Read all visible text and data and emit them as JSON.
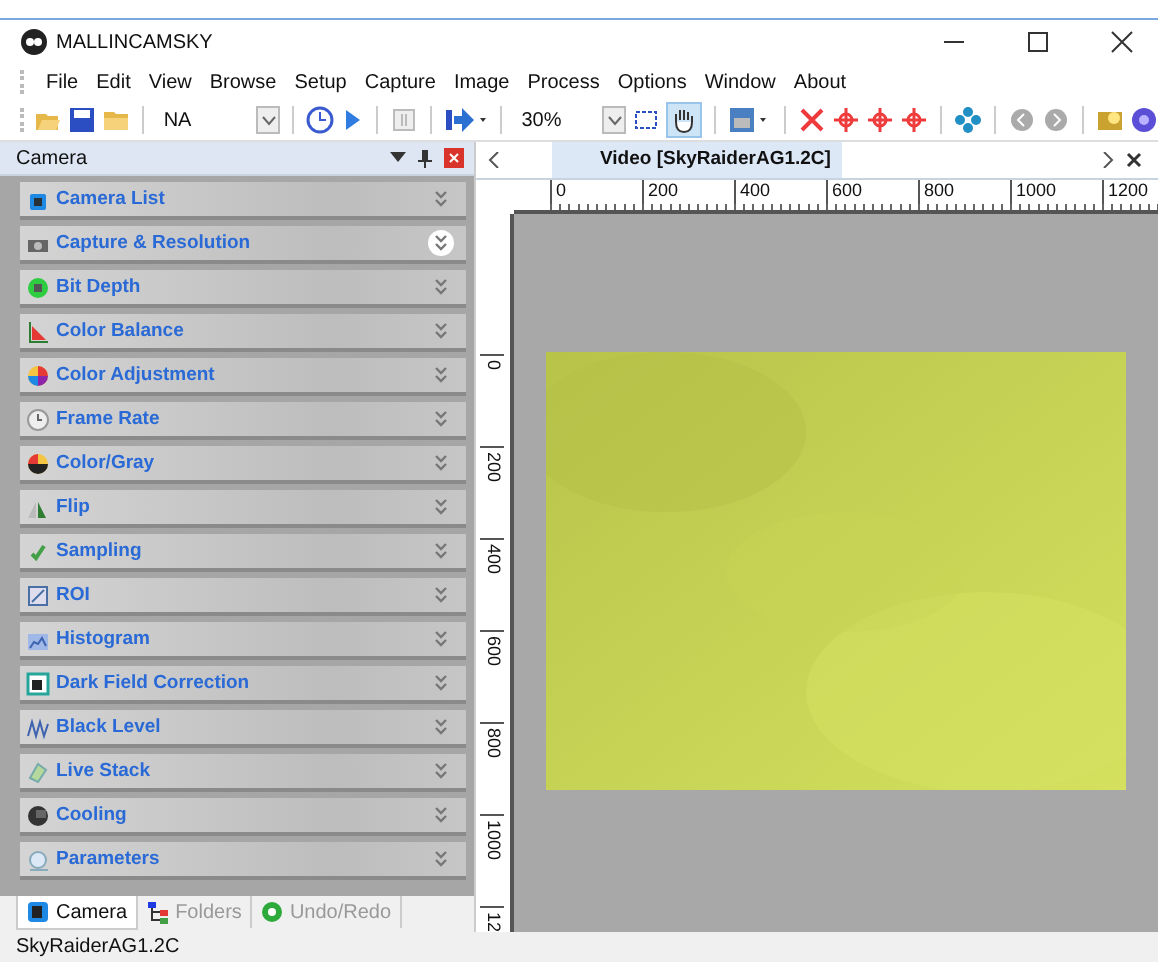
{
  "window": {
    "title": "MALLINCAMSKY"
  },
  "menu": [
    "File",
    "Edit",
    "View",
    "Browse",
    "Setup",
    "Capture",
    "Image",
    "Process",
    "Options",
    "Window",
    "About"
  ],
  "toolbar": {
    "camera_combo": "NA",
    "zoom_combo": "30%",
    "hand_pressed": true
  },
  "panel": {
    "title": "Camera",
    "sections": [
      {
        "label": "Camera List",
        "highlighted": false
      },
      {
        "label": "Capture & Resolution",
        "highlighted": true
      },
      {
        "label": "Bit Depth",
        "highlighted": false
      },
      {
        "label": "Color Balance",
        "highlighted": false
      },
      {
        "label": "Color Adjustment",
        "highlighted": false
      },
      {
        "label": "Frame Rate",
        "highlighted": false
      },
      {
        "label": "Color/Gray",
        "highlighted": false
      },
      {
        "label": "Flip",
        "highlighted": false
      },
      {
        "label": "Sampling",
        "highlighted": false
      },
      {
        "label": "ROI",
        "highlighted": false
      },
      {
        "label": "Histogram",
        "highlighted": false
      },
      {
        "label": "Dark Field Correction",
        "highlighted": false
      },
      {
        "label": "Black Level",
        "highlighted": false
      },
      {
        "label": "Live Stack",
        "highlighted": false
      },
      {
        "label": "Cooling",
        "highlighted": false
      },
      {
        "label": "Parameters",
        "highlighted": false
      }
    ],
    "tabs": [
      {
        "label": "Camera",
        "selected": true
      },
      {
        "label": "Folders",
        "selected": false
      },
      {
        "label": "Undo/Redo",
        "selected": false
      }
    ]
  },
  "document": {
    "tab": "Video [SkyRaiderAG1.2C]",
    "hruler": [
      "0",
      "200",
      "400",
      "600",
      "800",
      "1000",
      "1200"
    ],
    "vruler": [
      "0",
      "200",
      "400",
      "600",
      "800",
      "1000",
      "12"
    ]
  },
  "status_bar": "SkyRaiderAG1.2C"
}
